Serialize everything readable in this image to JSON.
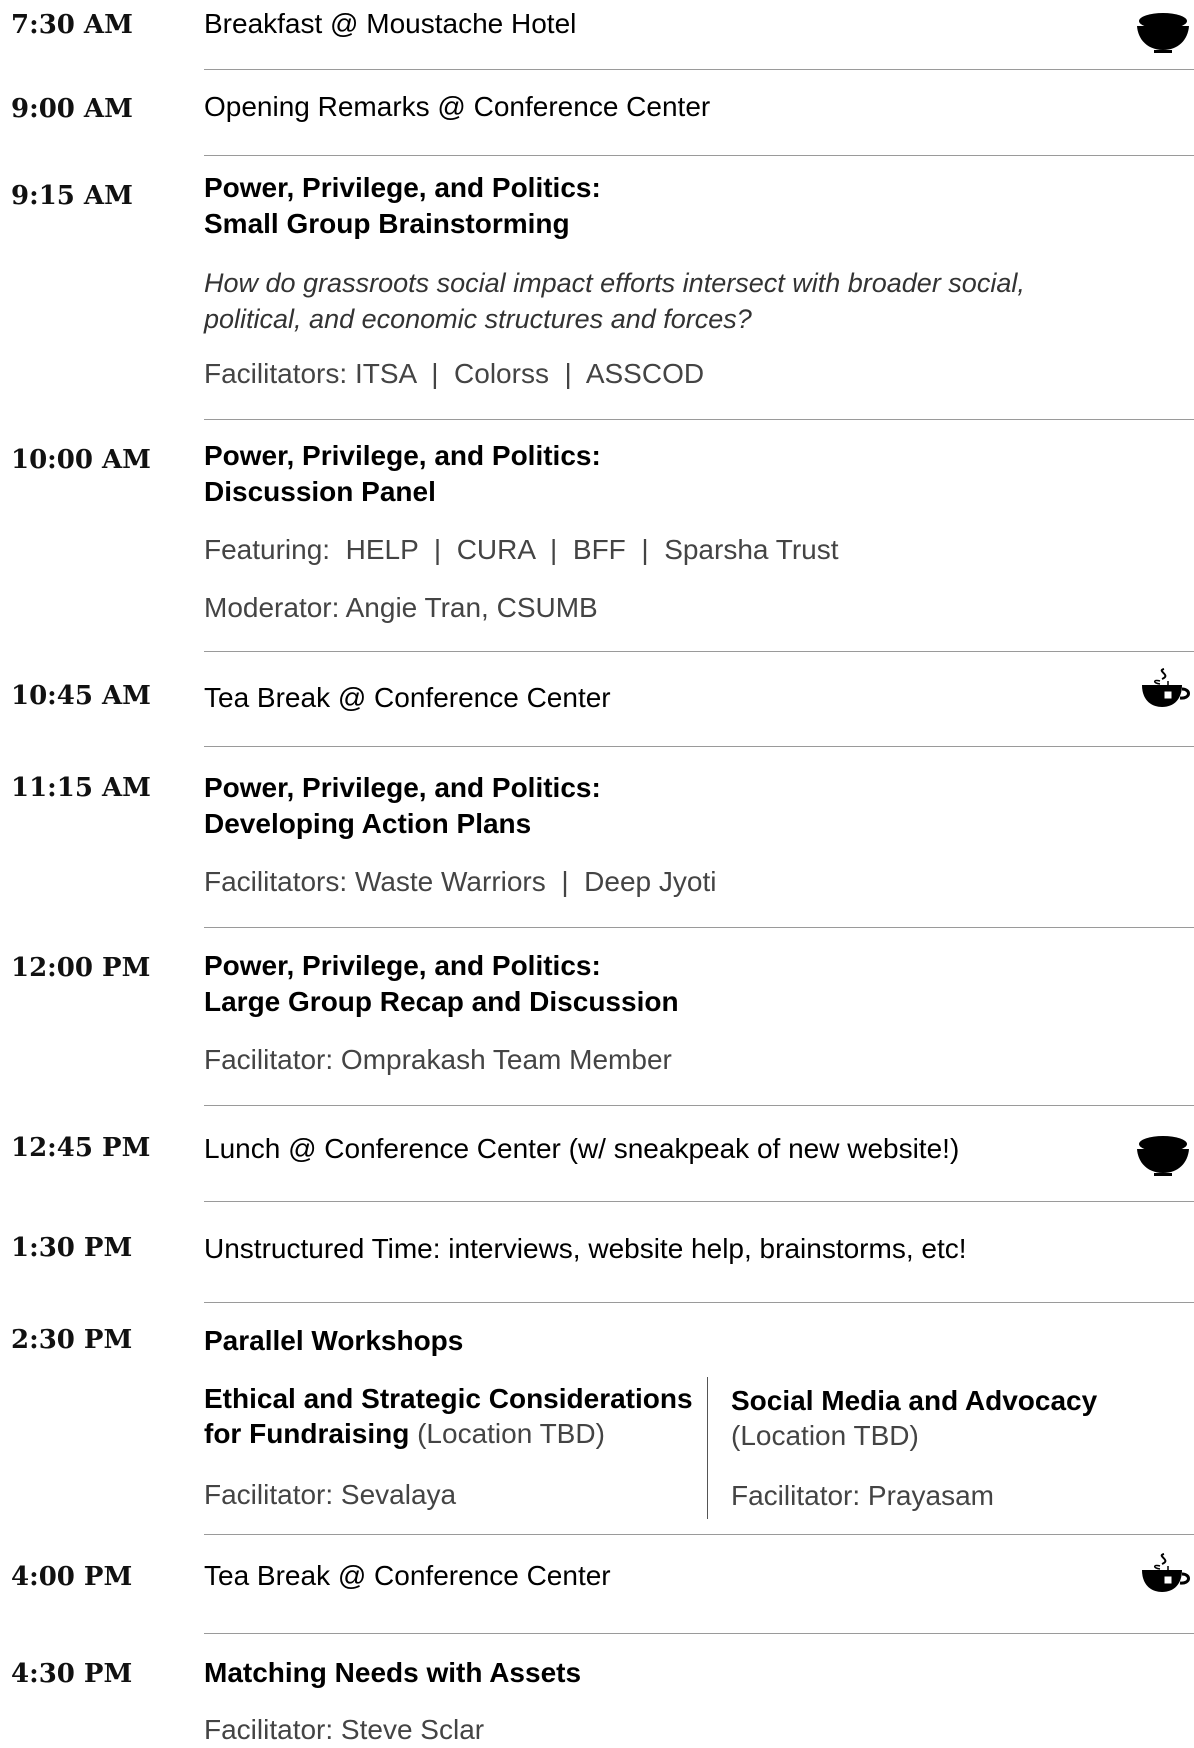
{
  "sessions": {
    "s1": {
      "time": "7:30 AM",
      "title": "Breakfast @ Moustache Hotel"
    },
    "s2": {
      "time": "9:00 AM",
      "title": "Opening Remarks @ Conference Center"
    },
    "s3": {
      "time": "9:15 AM",
      "title_line1": "Power, Privilege, and Politics:",
      "title_line2": "Small Group Brainstorming",
      "question_line1": "How do grassroots social impact efforts intersect with broader social,",
      "question_line2": "political, and economic structures and forces?",
      "facilitators_label": "Facilitators:",
      "facilitators": [
        "ITSA",
        "Colorss",
        "ASSCOD"
      ]
    },
    "s4": {
      "time": "10:00 AM",
      "title_line1": "Power, Privilege, and Politics:",
      "title_line2": "Discussion Panel",
      "featuring_label": "Featuring:",
      "featuring": [
        "HELP",
        "CURA",
        "BFF",
        "Sparsha Trust"
      ],
      "moderator": "Moderator: Angie Tran, CSUMB"
    },
    "s5": {
      "time": "10:45 AM",
      "title": "Tea Break @ Conference Center"
    },
    "s6": {
      "time": "11:15 AM",
      "title_line1": "Power, Privilege, and Politics:",
      "title_line2": "Developing Action Plans",
      "facilitators_label": "Facilitators:",
      "facilitators": [
        "Waste Warriors",
        "Deep Jyoti"
      ]
    },
    "s7": {
      "time": "12:00 PM",
      "title_line1": "Power, Privilege, and Politics:",
      "title_line2": "Large Group Recap and Discussion",
      "facilitator": "Facilitator: Omprakash Team Member"
    },
    "s8": {
      "time": "12:45 PM",
      "title": "Lunch @ Conference Center (w/ sneakpeak of new website!)"
    },
    "s9": {
      "time": "1:30 PM",
      "title": "Unstructured Time: interviews, website help, brainstorms, etc!"
    },
    "s10": {
      "time": "2:30 PM",
      "title": "Parallel Workshops",
      "left": {
        "title_line1": "Ethical and Strategic Considerations",
        "title_line2": "for Fundraising",
        "location": "(Location TBD)",
        "facilitator": "Facilitator: Sevalaya"
      },
      "right": {
        "title": "Social Media and Advocacy",
        "location": "(Location TBD)",
        "facilitator": "Facilitator: Prayasam"
      }
    },
    "s11": {
      "time": "4:00 PM",
      "title": "Tea Break @ Conference Center"
    },
    "s12": {
      "time": "4:30 PM",
      "title": "Matching Needs with Assets",
      "facilitator": "Facilitator: Steve Sclar"
    }
  },
  "separator": "|",
  "icons": {
    "meal": "rice-bowl-icon",
    "tea": "tea-cup-icon"
  }
}
